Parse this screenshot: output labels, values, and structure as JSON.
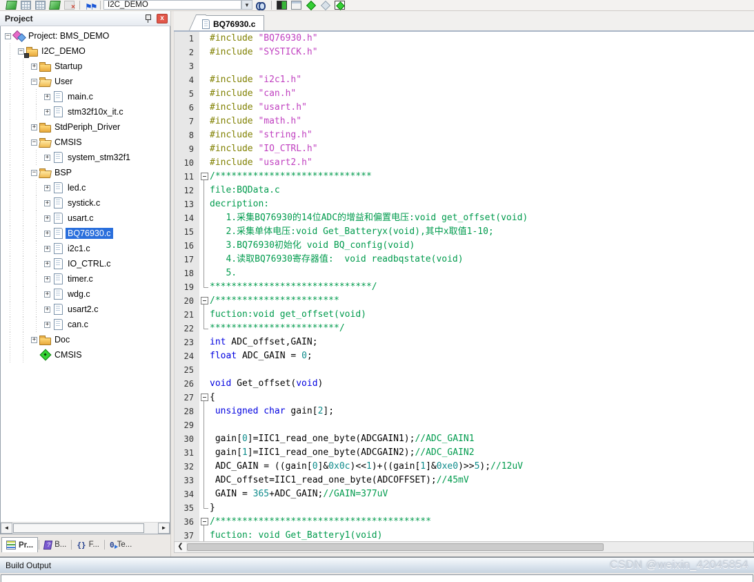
{
  "toolbar": {
    "target_select": "I2C_DEMO",
    "items": [
      {
        "type": "layers",
        "name": "system-viewer-icon"
      },
      {
        "type": "grid",
        "name": "memory-window-icon"
      },
      {
        "type": "grid",
        "name": "memory-window-2-icon"
      },
      {
        "type": "layers",
        "name": "logic-analyzer-icon"
      },
      {
        "type": "dimx",
        "name": "stop-refresh-icon"
      },
      {
        "type": "sep",
        "name": "toolbar-separator"
      },
      {
        "type": "flags",
        "name": "insert-flag-icon"
      },
      {
        "type": "sep",
        "name": "toolbar-separator"
      },
      {
        "type": "combo",
        "name": "target-select-combo",
        "value": "I2C_DEMO"
      },
      {
        "type": "drop",
        "name": "target-select-dropdown",
        "glyph": "▼"
      },
      {
        "type": "binoc",
        "name": "find-in-files-icon"
      },
      {
        "type": "sep",
        "name": "toolbar-separator"
      },
      {
        "type": "splitbox",
        "name": "options-for-target-icon"
      },
      {
        "type": "window",
        "name": "file-extensions-icon"
      },
      {
        "type": "diamond-green",
        "name": "manage-rte-icon"
      },
      {
        "type": "diamond-gray",
        "name": "select-software-packs-icon"
      },
      {
        "type": "diamond-boxed",
        "name": "pack-installer-icon"
      }
    ]
  },
  "project_panel": {
    "title": "Project",
    "pin_icon": "pin-icon",
    "close_icon": "x",
    "tree": [
      {
        "label": "Project: BMS_DEMO",
        "level": 0,
        "exp": "-",
        "icon": "project"
      },
      {
        "label": "I2C_DEMO",
        "level": 1,
        "exp": "-",
        "icon": "target"
      },
      {
        "label": "Startup",
        "level": 2,
        "exp": "+",
        "icon": "folder"
      },
      {
        "label": "User",
        "level": 2,
        "exp": "-",
        "icon": "folder-open"
      },
      {
        "label": "main.c",
        "level": 3,
        "exp": "+",
        "icon": "file"
      },
      {
        "label": "stm32f10x_it.c",
        "level": 3,
        "exp": "+",
        "icon": "file"
      },
      {
        "label": "StdPeriph_Driver",
        "level": 2,
        "exp": "+",
        "icon": "folder"
      },
      {
        "label": "CMSIS",
        "level": 2,
        "exp": "-",
        "icon": "folder-open"
      },
      {
        "label": "system_stm32f1",
        "level": 3,
        "exp": "+",
        "icon": "file"
      },
      {
        "label": "BSP",
        "level": 2,
        "exp": "-",
        "icon": "folder-open"
      },
      {
        "label": "led.c",
        "level": 3,
        "exp": "+",
        "icon": "file"
      },
      {
        "label": "systick.c",
        "level": 3,
        "exp": "+",
        "icon": "file"
      },
      {
        "label": "usart.c",
        "level": 3,
        "exp": "+",
        "icon": "file"
      },
      {
        "label": "BQ76930.c",
        "level": 3,
        "exp": "+",
        "icon": "file",
        "selected": true
      },
      {
        "label": "i2c1.c",
        "level": 3,
        "exp": "+",
        "icon": "file"
      },
      {
        "label": "IO_CTRL.c",
        "level": 3,
        "exp": "+",
        "icon": "file"
      },
      {
        "label": "timer.c",
        "level": 3,
        "exp": "+",
        "icon": "file"
      },
      {
        "label": "wdg.c",
        "level": 3,
        "exp": "+",
        "icon": "file"
      },
      {
        "label": "usart2.c",
        "level": 3,
        "exp": "+",
        "icon": "file"
      },
      {
        "label": "can.c",
        "level": 3,
        "exp": "+",
        "icon": "file"
      },
      {
        "label": "Doc",
        "level": 2,
        "exp": "+",
        "icon": "folder"
      },
      {
        "label": "CMSIS",
        "level": 2,
        "exp": "",
        "icon": "pack"
      }
    ],
    "bottom_tabs": [
      {
        "label": "Pr...",
        "icon": "project-tab",
        "active": true
      },
      {
        "label": "B...",
        "icon": "books",
        "active": false
      },
      {
        "label": "F...",
        "icon": "functions",
        "active": false
      },
      {
        "label": "Te...",
        "icon": "templates",
        "active": false
      }
    ],
    "tab_icon_glyphs": {
      "functions": "{}",
      "templates": "0"
    }
  },
  "editor": {
    "tab": "BQ76930.c",
    "lines": [
      {
        "n": 1,
        "fold": "",
        "segs": [
          [
            "#include ",
            "pp"
          ],
          [
            "\"BQ76930.h\"",
            "str"
          ]
        ]
      },
      {
        "n": 2,
        "fold": "",
        "segs": [
          [
            "#include ",
            "pp"
          ],
          [
            "\"SYSTICK.h\"",
            "str"
          ]
        ]
      },
      {
        "n": 3,
        "fold": "",
        "segs": []
      },
      {
        "n": 4,
        "fold": "",
        "segs": [
          [
            "#include ",
            "pp"
          ],
          [
            "\"i2c1.h\"",
            "str"
          ]
        ]
      },
      {
        "n": 5,
        "fold": "",
        "segs": [
          [
            "#include ",
            "pp"
          ],
          [
            "\"can.h\"",
            "str"
          ]
        ]
      },
      {
        "n": 6,
        "fold": "",
        "segs": [
          [
            "#include ",
            "pp"
          ],
          [
            "\"usart.h\"",
            "str"
          ]
        ]
      },
      {
        "n": 7,
        "fold": "",
        "segs": [
          [
            "#include ",
            "pp"
          ],
          [
            "\"math.h\"",
            "str"
          ]
        ]
      },
      {
        "n": 8,
        "fold": "",
        "segs": [
          [
            "#include ",
            "pp"
          ],
          [
            "\"string.h\"",
            "str"
          ]
        ]
      },
      {
        "n": 9,
        "fold": "",
        "segs": [
          [
            "#include ",
            "pp"
          ],
          [
            "\"IO_CTRL.h\"",
            "str"
          ]
        ]
      },
      {
        "n": 10,
        "fold": "",
        "segs": [
          [
            "#include ",
            "pp"
          ],
          [
            "\"usart2.h\"",
            "str"
          ]
        ]
      },
      {
        "n": 11,
        "fold": "open",
        "segs": [
          [
            "/*****************************",
            "cm"
          ]
        ]
      },
      {
        "n": 12,
        "fold": "line",
        "segs": [
          [
            "file:BQData.c",
            "cm"
          ]
        ]
      },
      {
        "n": 13,
        "fold": "line",
        "segs": [
          [
            "decription:",
            "cm"
          ]
        ]
      },
      {
        "n": 14,
        "fold": "line",
        "segs": [
          [
            "   1.采集BQ76930的14位ADC的增益和偏置电压:void get_offset(void)",
            "cm"
          ]
        ]
      },
      {
        "n": 15,
        "fold": "line",
        "segs": [
          [
            "   2.采集单体电压:void Get_Batteryx(void),其中x取值1-10;",
            "cm"
          ]
        ]
      },
      {
        "n": 16,
        "fold": "line",
        "segs": [
          [
            "   3.BQ76930初始化 void BQ_config(void)",
            "cm"
          ]
        ]
      },
      {
        "n": 17,
        "fold": "line",
        "segs": [
          [
            "   4.读取BQ76930寄存器值:  void readbqstate(void)",
            "cm"
          ]
        ]
      },
      {
        "n": 18,
        "fold": "line",
        "segs": [
          [
            "   5.",
            "cm"
          ]
        ]
      },
      {
        "n": 19,
        "fold": "end",
        "segs": [
          [
            "******************************/",
            "cm"
          ]
        ]
      },
      {
        "n": 20,
        "fold": "open",
        "segs": [
          [
            "/***********************",
            "cm"
          ]
        ]
      },
      {
        "n": 21,
        "fold": "line",
        "segs": [
          [
            "fuction:void get_offset(void)",
            "cm"
          ]
        ]
      },
      {
        "n": 22,
        "fold": "end",
        "segs": [
          [
            "************************/",
            "cm"
          ]
        ]
      },
      {
        "n": 23,
        "fold": "",
        "segs": [
          [
            "int",
            "kw"
          ],
          [
            " ADC_offset,GAIN;",
            "pl"
          ]
        ]
      },
      {
        "n": 24,
        "fold": "",
        "segs": [
          [
            "float",
            "kw"
          ],
          [
            " ADC_GAIN = ",
            "pl"
          ],
          [
            "0",
            "num"
          ],
          [
            ";",
            "pl"
          ]
        ]
      },
      {
        "n": 25,
        "fold": "",
        "segs": []
      },
      {
        "n": 26,
        "fold": "",
        "segs": [
          [
            "void",
            "kw"
          ],
          [
            " Get_offset(",
            "pl"
          ],
          [
            "void",
            "kw"
          ],
          [
            ")",
            "pl"
          ]
        ]
      },
      {
        "n": 27,
        "fold": "open",
        "segs": [
          [
            "{",
            "pl"
          ]
        ]
      },
      {
        "n": 28,
        "fold": "line",
        "segs": [
          [
            " ",
            "pl"
          ],
          [
            "unsigned",
            "kw"
          ],
          [
            " ",
            "pl"
          ],
          [
            "char",
            "kw"
          ],
          [
            " gain[",
            "pl"
          ],
          [
            "2",
            "num"
          ],
          [
            "];",
            "pl"
          ]
        ]
      },
      {
        "n": 29,
        "fold": "line",
        "segs": []
      },
      {
        "n": 30,
        "fold": "line",
        "segs": [
          [
            " gain[",
            "pl"
          ],
          [
            "0",
            "num"
          ],
          [
            "]=IIC1_read_one_byte(ADCGAIN1);",
            "pl"
          ],
          [
            "//ADC_GAIN1",
            "cm"
          ]
        ]
      },
      {
        "n": 31,
        "fold": "line",
        "segs": [
          [
            " gain[",
            "pl"
          ],
          [
            "1",
            "num"
          ],
          [
            "]=IIC1_read_one_byte(ADCGAIN2);",
            "pl"
          ],
          [
            "//ADC_GAIN2",
            "cm"
          ]
        ]
      },
      {
        "n": 32,
        "fold": "line",
        "segs": [
          [
            " ADC_GAIN = ((gain[",
            "pl"
          ],
          [
            "0",
            "num"
          ],
          [
            "]&",
            "pl"
          ],
          [
            "0x0c",
            "num"
          ],
          [
            ")<<",
            "pl"
          ],
          [
            "1",
            "num"
          ],
          [
            ")+((gain[",
            "pl"
          ],
          [
            "1",
            "num"
          ],
          [
            "]&",
            "pl"
          ],
          [
            "0xe0",
            "num"
          ],
          [
            ")>>",
            "pl"
          ],
          [
            "5",
            "num"
          ],
          [
            ");",
            "pl"
          ],
          [
            "//12uV",
            "cm"
          ]
        ]
      },
      {
        "n": 33,
        "fold": "line",
        "segs": [
          [
            " ADC_offset=IIC1_read_one_byte(ADCOFFSET);",
            "pl"
          ],
          [
            "//45mV",
            "cm"
          ]
        ]
      },
      {
        "n": 34,
        "fold": "line",
        "segs": [
          [
            " GAIN = ",
            "pl"
          ],
          [
            "365",
            "num"
          ],
          [
            "+ADC_GAIN;",
            "pl"
          ],
          [
            "//GAIN=377uV",
            "cm"
          ]
        ]
      },
      {
        "n": 35,
        "fold": "end",
        "segs": [
          [
            "}",
            "pl"
          ]
        ]
      },
      {
        "n": 36,
        "fold": "open",
        "segs": [
          [
            "/****************************************",
            "cm"
          ]
        ]
      },
      {
        "n": 37,
        "fold": "line",
        "segs": [
          [
            "fuction: void Get_Battery1(void)",
            "cm"
          ]
        ]
      }
    ],
    "syntax_colors": {
      "preprocessor": "#808000",
      "string": "#c040c0",
      "comment": "#009b4d",
      "keyword": "#0000e0",
      "number": "#0e8b8b",
      "plain": "#000000"
    }
  },
  "build_output": {
    "title": "Build Output",
    "watermark": "CSDN @weixin_42045854"
  },
  "selection_color": "#2a6fdc"
}
